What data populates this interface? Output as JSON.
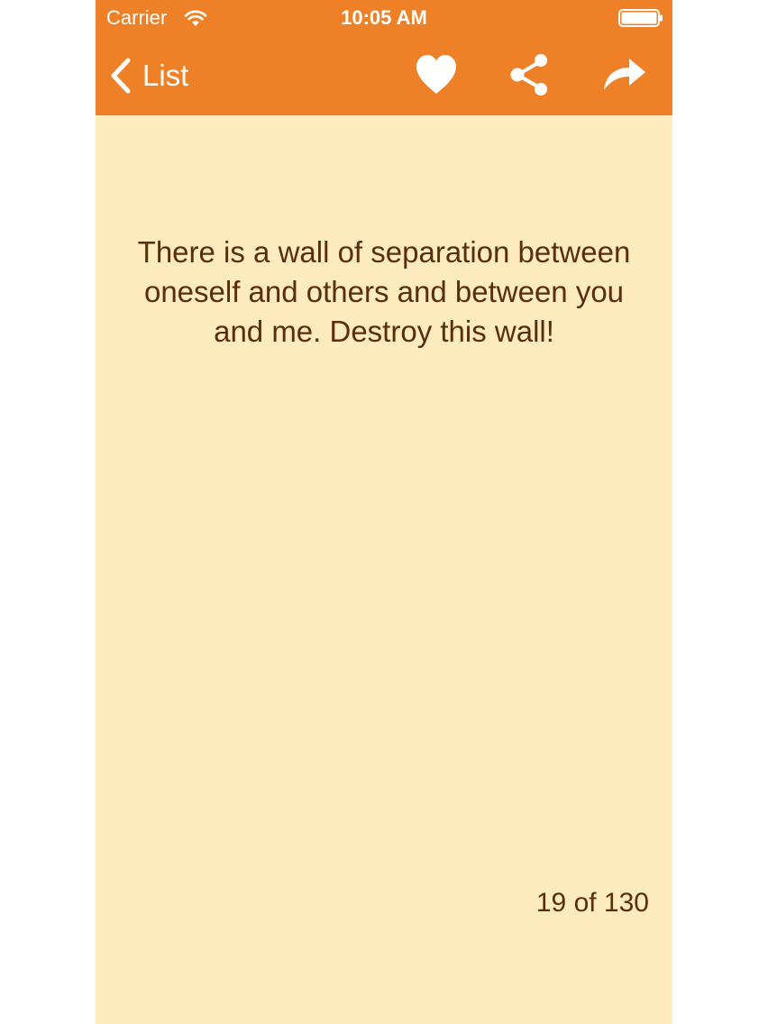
{
  "status_bar": {
    "carrier": "Carrier",
    "time": "10:05 AM",
    "wifi_icon": "wifi-icon",
    "battery_icon": "battery-icon"
  },
  "nav": {
    "back_label": "List",
    "back_icon": "chevron-left-icon",
    "actions": [
      {
        "icon": "heart-icon"
      },
      {
        "icon": "share-icon"
      },
      {
        "icon": "forward-icon"
      }
    ]
  },
  "content": {
    "quote": "There is a wall of separation between oneself and others and between you and me. Destroy this wall!",
    "page_counter": "19 of 130"
  },
  "colors": {
    "bar": "#ee8128",
    "background": "#feecbf",
    "text": "#5a2d0c",
    "bar_text": "#ffffff"
  }
}
